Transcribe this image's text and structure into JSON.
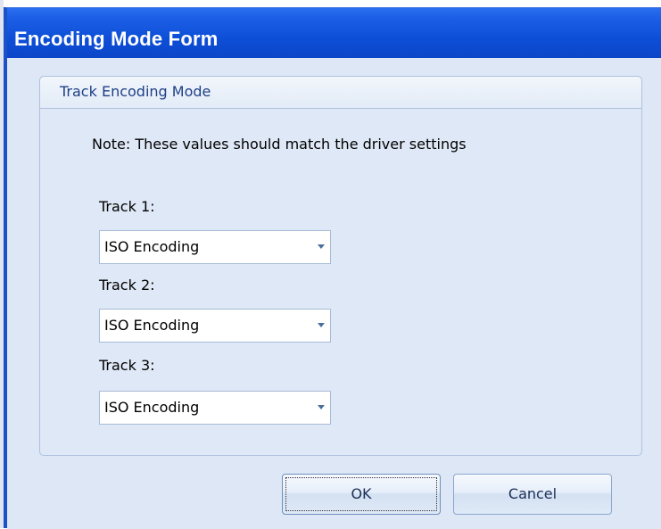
{
  "window": {
    "title": "Encoding Mode Form"
  },
  "group": {
    "title": "Track Encoding Mode"
  },
  "note": "Note: These values should match the driver settings",
  "tracks": [
    {
      "label": "Track 1:",
      "value": "ISO Encoding"
    },
    {
      "label": "Track 2:",
      "value": "ISO Encoding"
    },
    {
      "label": "Track 3:",
      "value": "ISO Encoding"
    }
  ],
  "buttons": {
    "ok_label": "OK",
    "cancel_label": "Cancel"
  },
  "icons": {
    "dropdown": "chevron-down-icon"
  },
  "colors": {
    "titlebar": "#0e4fd8",
    "client_background": "#dde7f5",
    "group_border": "#aec2dd",
    "group_title": "#1e3f86"
  }
}
